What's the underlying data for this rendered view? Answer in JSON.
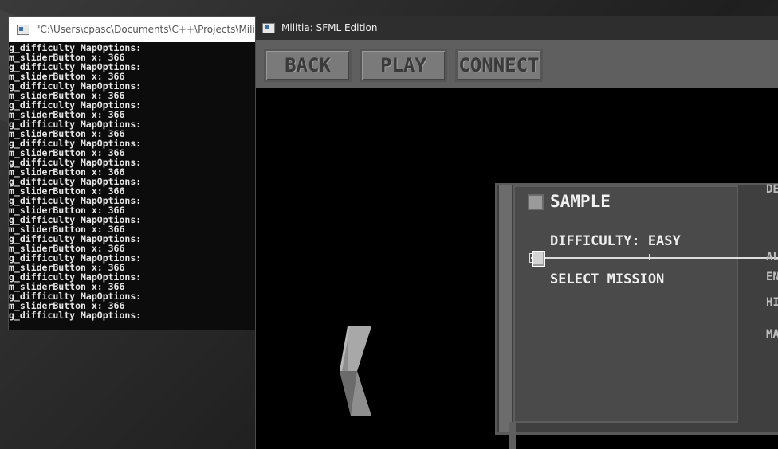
{
  "console": {
    "title": "\"C:\\Users\\cpasc\\Documents\\C++\\Projects\\Militia SF",
    "lines": [
      "g_difficulty MapOptions:",
      "m_sliderButton x: 366",
      "g_difficulty MapOptions:",
      "m_sliderButton x: 366",
      "g_difficulty MapOptions:",
      "m_sliderButton x: 366",
      "g_difficulty MapOptions:",
      "m_sliderButton x: 366",
      "g_difficulty MapOptions:",
      "m_sliderButton x: 366",
      "g_difficulty MapOptions:",
      "m_sliderButton x: 366",
      "g_difficulty MapOptions:",
      "m_sliderButton x: 366",
      "g_difficulty MapOptions:",
      "m_sliderButton x: 366",
      "g_difficulty MapOptions:",
      "m_sliderButton x: 366",
      "g_difficulty MapOptions:",
      "m_sliderButton x: 366",
      "g_difficulty MapOptions:",
      "m_sliderButton x: 366",
      "g_difficulty MapOptions:",
      "m_sliderButton x: 366",
      "g_difficulty MapOptions:",
      "m_sliderButton x: 366",
      "g_difficulty MapOptions:",
      "m_sliderButton x: 366",
      "g_difficulty MapOptions:"
    ]
  },
  "game": {
    "title": "Militia: SFML Edition",
    "toolbar": {
      "back_label": "BACK",
      "play_label": "PLAY",
      "connect_label": "CONNECT"
    },
    "panel": {
      "title": "SAMPLE",
      "difficulty_label": "DIFFICULTY: EASY",
      "select_mission_label": "SELECT MISSION",
      "difficulty_slider_value": 0
    },
    "right_labels": [
      "DE",
      "AL",
      "EN",
      "HI",
      "MA"
    ]
  },
  "colors": {
    "toolbar_bg": "#5f5f5f",
    "button_bg": "#7a7a7a",
    "panel_bg": "#4a4a4a",
    "console_bg": "#0c0c0c"
  }
}
